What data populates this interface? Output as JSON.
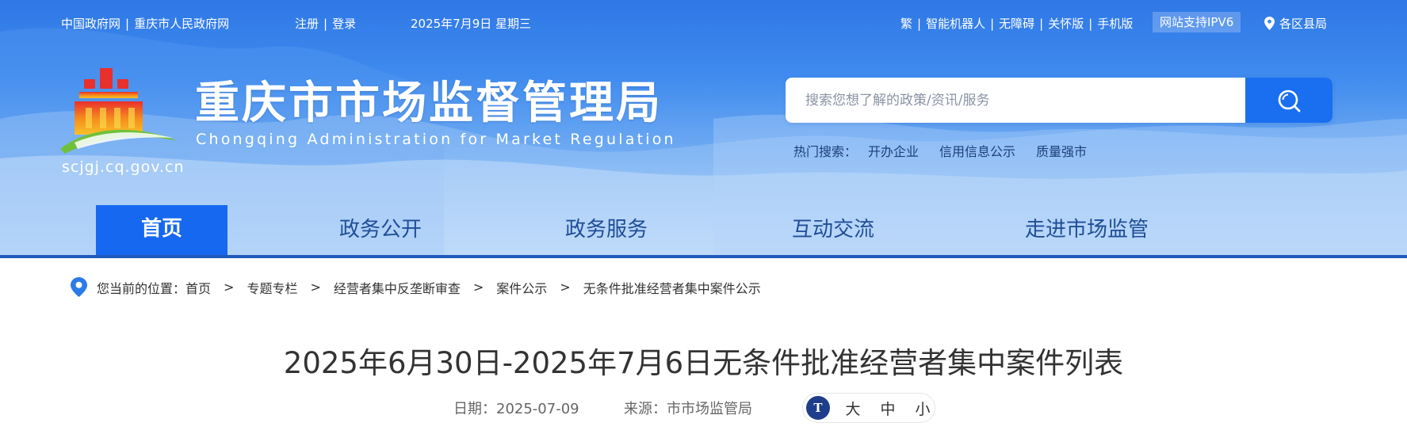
{
  "topbar": {
    "links_left": [
      "中国政府网",
      "重庆市人民政府网"
    ],
    "auth": [
      "注册",
      "登录"
    ],
    "date": "2025年7月9日 星期三",
    "links_right": [
      "繁",
      "智能机器人",
      "无障碍",
      "关怀版",
      "手机版"
    ],
    "ipv6": "网站支持IPV6",
    "region": "各区县局"
  },
  "site": {
    "name_cn": "重庆市市场监督管理局",
    "name_en": "Chongqing  Administration for Market Regulation",
    "domain": "scjgj.cq.gov.cn"
  },
  "search": {
    "placeholder": "搜索您想了解的政策/资讯/服务",
    "hot_label": "热门搜索：",
    "hot_items": [
      "开办企业",
      "信用信息公示",
      "质量强市"
    ]
  },
  "nav": {
    "items": [
      "首页",
      "政务公开",
      "政务服务",
      "互动交流",
      "走进市场监管"
    ]
  },
  "breadcrumb": {
    "prefix": "您当前的位置：",
    "items": [
      "首页",
      "专题专栏",
      "经营者集中反垄断审查",
      "案件公示",
      "无条件批准经营者集中案件公示"
    ],
    "separator": ">"
  },
  "article": {
    "title": "2025年6月30日-2025年7月6日无条件批准经营者集中案件列表",
    "date": "日期：2025-07-09",
    "source": "来源：市市场监管局",
    "font_size_options": [
      "大",
      "中",
      "小"
    ]
  },
  "colors": {
    "nav_active": "#1668f0",
    "nav_active_underline": "#e0202a",
    "search_button": "#1a6ff0"
  }
}
